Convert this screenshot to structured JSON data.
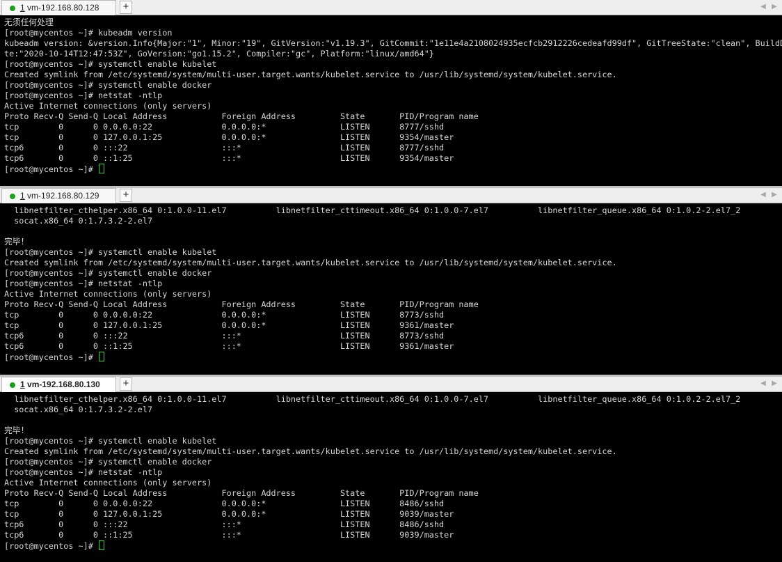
{
  "panes": [
    {
      "tab": {
        "number": "1",
        "title": "vm-192.168.80.128",
        "add_label": "+"
      },
      "nav": {
        "left": "◀",
        "right": "▶"
      },
      "lines": [
        "无须任何处理",
        "[root@mycentos ~]# kubeadm version",
        "kubeadm version: &version.Info{Major:\"1\", Minor:\"19\", GitVersion:\"v1.19.3\", GitCommit:\"1e11e4a2108024935ecfcb2912226cedeafd99df\", GitTreeState:\"clean\", BuildDa",
        "te:\"2020-10-14T12:47:53Z\", GoVersion:\"go1.15.2\", Compiler:\"gc\", Platform:\"linux/amd64\"}",
        "[root@mycentos ~]# systemctl enable kubelet",
        "Created symlink from /etc/systemd/system/multi-user.target.wants/kubelet.service to /usr/lib/systemd/system/kubelet.service.",
        "[root@mycentos ~]# systemctl enable docker",
        "[root@mycentos ~]# netstat -ntlp",
        "Active Internet connections (only servers)",
        "Proto Recv-Q Send-Q Local Address           Foreign Address         State       PID/Program name",
        "tcp        0      0 0.0.0.0:22              0.0.0.0:*               LISTEN      8777/sshd",
        "tcp        0      0 127.0.0.1:25            0.0.0.0:*               LISTEN      9354/master",
        "tcp6       0      0 :::22                   :::*                    LISTEN      8777/sshd",
        "tcp6       0      0 ::1:25                  :::*                    LISTEN      9354/master"
      ],
      "prompt": "[root@mycentos ~]# "
    },
    {
      "tab": {
        "number": "1",
        "title": "vm-192.168.80.129",
        "add_label": "+"
      },
      "nav": {
        "left": "◀",
        "right": "▶"
      },
      "lines": [
        "  libnetfilter_cthelper.x86_64 0:1.0.0-11.el7          libnetfilter_cttimeout.x86_64 0:1.0.0-7.el7          libnetfilter_queue.x86_64 0:1.0.2-2.el7_2",
        "  socat.x86_64 0:1.7.3.2-2.el7",
        "",
        "完毕！",
        "[root@mycentos ~]# systemctl enable kubelet",
        "Created symlink from /etc/systemd/system/multi-user.target.wants/kubelet.service to /usr/lib/systemd/system/kubelet.service.",
        "[root@mycentos ~]# systemctl enable docker",
        "[root@mycentos ~]# netstat -ntlp",
        "Active Internet connections (only servers)",
        "Proto Recv-Q Send-Q Local Address           Foreign Address         State       PID/Program name",
        "tcp        0      0 0.0.0.0:22              0.0.0.0:*               LISTEN      8773/sshd",
        "tcp        0      0 127.0.0.1:25            0.0.0.0:*               LISTEN      9361/master",
        "tcp6       0      0 :::22                   :::*                    LISTEN      8773/sshd",
        "tcp6       0      0 ::1:25                  :::*                    LISTEN      9361/master"
      ],
      "prompt": "[root@mycentos ~]# "
    },
    {
      "tab": {
        "number": "1",
        "title": "vm-192.168.80.130",
        "add_label": "+"
      },
      "nav": {
        "left": "◀",
        "right": "▶"
      },
      "lines": [
        "  libnetfilter_cthelper.x86_64 0:1.0.0-11.el7          libnetfilter_cttimeout.x86_64 0:1.0.0-7.el7          libnetfilter_queue.x86_64 0:1.0.2-2.el7_2",
        "  socat.x86_64 0:1.7.3.2-2.el7",
        "",
        "完毕！",
        "[root@mycentos ~]# systemctl enable kubelet",
        "Created symlink from /etc/systemd/system/multi-user.target.wants/kubelet.service to /usr/lib/systemd/system/kubelet.service.",
        "[root@mycentos ~]# systemctl enable docker",
        "[root@mycentos ~]# netstat -ntlp",
        "Active Internet connections (only servers)",
        "Proto Recv-Q Send-Q Local Address           Foreign Address         State       PID/Program name",
        "tcp        0      0 0.0.0.0:22              0.0.0.0:*               LISTEN      8486/sshd",
        "tcp        0      0 127.0.0.1:25            0.0.0.0:*               LISTEN      9039/master",
        "tcp6       0      0 :::22                   :::*                    LISTEN      8486/sshd",
        "tcp6       0      0 ::1:25                  :::*                    LISTEN      9039/master"
      ],
      "prompt": "[root@mycentos ~]# "
    }
  ],
  "colors": {
    "terminal_bg": "#000000",
    "terminal_fg": "#d6d6d6",
    "cursor": "#29d629",
    "connected_dot": "#1aa01a"
  }
}
